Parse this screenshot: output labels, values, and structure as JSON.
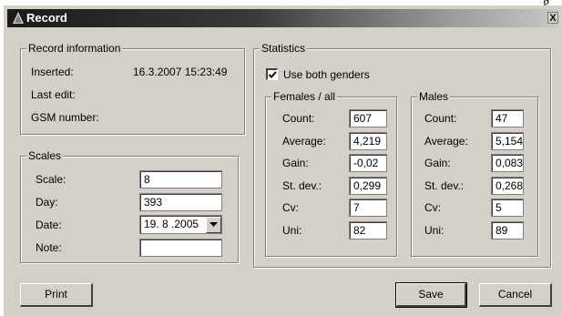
{
  "corner_letter": "g",
  "window": {
    "title": "Record",
    "close_symbol": "X"
  },
  "record_info": {
    "title": "Record information",
    "inserted_label": "Inserted:",
    "inserted_value": "16.3.2007 15:23:49",
    "last_edit_label": "Last edit:",
    "gsm_label": "GSM number:"
  },
  "scales": {
    "title": "Scales",
    "scale_label": "Scale:",
    "scale_value": "8",
    "day_label": "Day:",
    "day_value": "393",
    "date_label": "Date:",
    "date_value": "19. 8 .2005",
    "note_label": "Note:",
    "note_value": ""
  },
  "statistics": {
    "title": "Statistics",
    "use_both_genders_label": "Use both genders",
    "use_both_genders_checked": true,
    "females": {
      "title": "Females / all",
      "rows": [
        {
          "label": "Count:",
          "value": "607"
        },
        {
          "label": "Average:",
          "value": "4,219"
        },
        {
          "label": "Gain:",
          "value": "-0,02"
        },
        {
          "label": "St. dev.:",
          "value": "0,299"
        },
        {
          "label": "Cv:",
          "value": "7"
        },
        {
          "label": "Uni:",
          "value": "82"
        }
      ]
    },
    "males": {
      "title": "Males",
      "rows": [
        {
          "label": "Count:",
          "value": "47"
        },
        {
          "label": "Average:",
          "value": "5,154"
        },
        {
          "label": "Gain:",
          "value": "0,083"
        },
        {
          "label": "St. dev.:",
          "value": "0,268"
        },
        {
          "label": "Cv:",
          "value": "5"
        },
        {
          "label": "Uni:",
          "value": "89"
        }
      ]
    }
  },
  "buttons": {
    "print": "Print",
    "save": "Save",
    "cancel": "Cancel"
  },
  "icons": {
    "title_icon": "triangle-icon",
    "close": "close-icon",
    "dropdown": "chevron-down-icon",
    "check": "check-icon"
  },
  "colors": {
    "titlebar": "#1a1a1a",
    "face": "#d4d0c8"
  }
}
